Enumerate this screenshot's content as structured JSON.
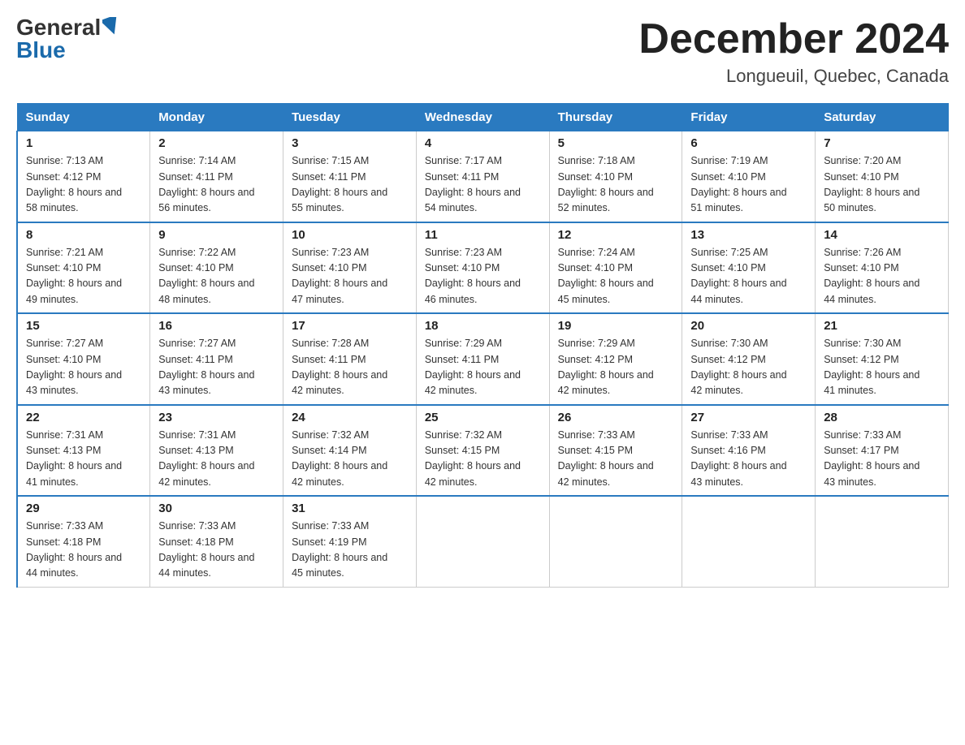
{
  "logo": {
    "general": "General",
    "blue": "Blue"
  },
  "title": "December 2024",
  "location": "Longueuil, Quebec, Canada",
  "days_of_week": [
    "Sunday",
    "Monday",
    "Tuesday",
    "Wednesday",
    "Thursday",
    "Friday",
    "Saturday"
  ],
  "weeks": [
    [
      {
        "day": "1",
        "sunrise": "7:13 AM",
        "sunset": "4:12 PM",
        "daylight": "8 hours and 58 minutes."
      },
      {
        "day": "2",
        "sunrise": "7:14 AM",
        "sunset": "4:11 PM",
        "daylight": "8 hours and 56 minutes."
      },
      {
        "day": "3",
        "sunrise": "7:15 AM",
        "sunset": "4:11 PM",
        "daylight": "8 hours and 55 minutes."
      },
      {
        "day": "4",
        "sunrise": "7:17 AM",
        "sunset": "4:11 PM",
        "daylight": "8 hours and 54 minutes."
      },
      {
        "day": "5",
        "sunrise": "7:18 AM",
        "sunset": "4:10 PM",
        "daylight": "8 hours and 52 minutes."
      },
      {
        "day": "6",
        "sunrise": "7:19 AM",
        "sunset": "4:10 PM",
        "daylight": "8 hours and 51 minutes."
      },
      {
        "day": "7",
        "sunrise": "7:20 AM",
        "sunset": "4:10 PM",
        "daylight": "8 hours and 50 minutes."
      }
    ],
    [
      {
        "day": "8",
        "sunrise": "7:21 AM",
        "sunset": "4:10 PM",
        "daylight": "8 hours and 49 minutes."
      },
      {
        "day": "9",
        "sunrise": "7:22 AM",
        "sunset": "4:10 PM",
        "daylight": "8 hours and 48 minutes."
      },
      {
        "day": "10",
        "sunrise": "7:23 AM",
        "sunset": "4:10 PM",
        "daylight": "8 hours and 47 minutes."
      },
      {
        "day": "11",
        "sunrise": "7:23 AM",
        "sunset": "4:10 PM",
        "daylight": "8 hours and 46 minutes."
      },
      {
        "day": "12",
        "sunrise": "7:24 AM",
        "sunset": "4:10 PM",
        "daylight": "8 hours and 45 minutes."
      },
      {
        "day": "13",
        "sunrise": "7:25 AM",
        "sunset": "4:10 PM",
        "daylight": "8 hours and 44 minutes."
      },
      {
        "day": "14",
        "sunrise": "7:26 AM",
        "sunset": "4:10 PM",
        "daylight": "8 hours and 44 minutes."
      }
    ],
    [
      {
        "day": "15",
        "sunrise": "7:27 AM",
        "sunset": "4:10 PM",
        "daylight": "8 hours and 43 minutes."
      },
      {
        "day": "16",
        "sunrise": "7:27 AM",
        "sunset": "4:11 PM",
        "daylight": "8 hours and 43 minutes."
      },
      {
        "day": "17",
        "sunrise": "7:28 AM",
        "sunset": "4:11 PM",
        "daylight": "8 hours and 42 minutes."
      },
      {
        "day": "18",
        "sunrise": "7:29 AM",
        "sunset": "4:11 PM",
        "daylight": "8 hours and 42 minutes."
      },
      {
        "day": "19",
        "sunrise": "7:29 AM",
        "sunset": "4:12 PM",
        "daylight": "8 hours and 42 minutes."
      },
      {
        "day": "20",
        "sunrise": "7:30 AM",
        "sunset": "4:12 PM",
        "daylight": "8 hours and 42 minutes."
      },
      {
        "day": "21",
        "sunrise": "7:30 AM",
        "sunset": "4:12 PM",
        "daylight": "8 hours and 41 minutes."
      }
    ],
    [
      {
        "day": "22",
        "sunrise": "7:31 AM",
        "sunset": "4:13 PM",
        "daylight": "8 hours and 41 minutes."
      },
      {
        "day": "23",
        "sunrise": "7:31 AM",
        "sunset": "4:13 PM",
        "daylight": "8 hours and 42 minutes."
      },
      {
        "day": "24",
        "sunrise": "7:32 AM",
        "sunset": "4:14 PM",
        "daylight": "8 hours and 42 minutes."
      },
      {
        "day": "25",
        "sunrise": "7:32 AM",
        "sunset": "4:15 PM",
        "daylight": "8 hours and 42 minutes."
      },
      {
        "day": "26",
        "sunrise": "7:33 AM",
        "sunset": "4:15 PM",
        "daylight": "8 hours and 42 minutes."
      },
      {
        "day": "27",
        "sunrise": "7:33 AM",
        "sunset": "4:16 PM",
        "daylight": "8 hours and 43 minutes."
      },
      {
        "day": "28",
        "sunrise": "7:33 AM",
        "sunset": "4:17 PM",
        "daylight": "8 hours and 43 minutes."
      }
    ],
    [
      {
        "day": "29",
        "sunrise": "7:33 AM",
        "sunset": "4:18 PM",
        "daylight": "8 hours and 44 minutes."
      },
      {
        "day": "30",
        "sunrise": "7:33 AM",
        "sunset": "4:18 PM",
        "daylight": "8 hours and 44 minutes."
      },
      {
        "day": "31",
        "sunrise": "7:33 AM",
        "sunset": "4:19 PM",
        "daylight": "8 hours and 45 minutes."
      },
      null,
      null,
      null,
      null
    ]
  ]
}
